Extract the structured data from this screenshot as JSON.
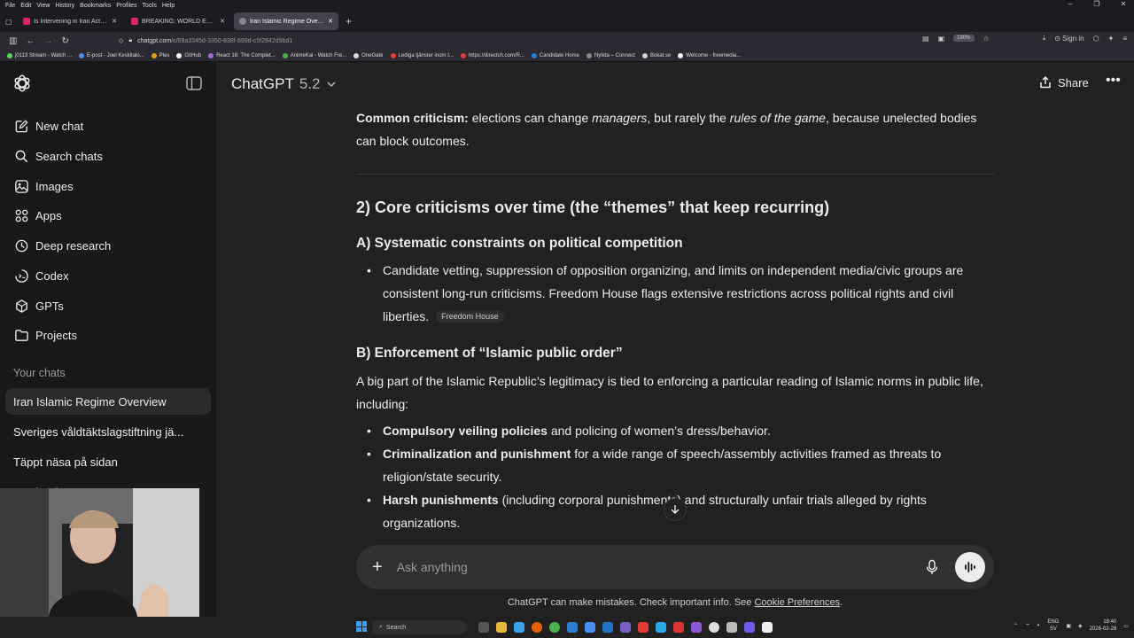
{
  "browser": {
    "menus": [
      "File",
      "Edit",
      "View",
      "History",
      "Bookmarks",
      "Profiles",
      "Tools",
      "Help"
    ],
    "tabs": [
      {
        "title": "Is Intervening in Iran Actually J..."
      },
      {
        "title": "BREAKING: WORLD ERUPTS AS..."
      },
      {
        "title": "Iran Islamic Regime Overview"
      }
    ],
    "url_host": "chatgpt.com",
    "url_path": "/c/69a3345d-3350-838f-899d-c5f2842d9bd1",
    "zoom": "190%",
    "sign_in": "Sign in",
    "bookmarks": [
      "j0113 Stream - Watch ...",
      "E-post - Joel Keskitalo...",
      "Plex",
      "GitHub",
      "React 16: The Complet...",
      "AnimeKai - Watch Fre...",
      "OneGate",
      "Lediga tjänster inom I...",
      "https://directch.com/R...",
      "Candidate Home",
      "Nytida – Connect",
      "Bokat.se",
      "Welcome - freemedia..."
    ]
  },
  "sidebar": {
    "items": [
      {
        "label": "New chat",
        "icon": "new-chat-icon"
      },
      {
        "label": "Search chats",
        "icon": "search-icon"
      },
      {
        "label": "Images",
        "icon": "images-icon"
      },
      {
        "label": "Apps",
        "icon": "apps-icon"
      },
      {
        "label": "Deep research",
        "icon": "deep-research-icon"
      },
      {
        "label": "Codex",
        "icon": "codex-icon"
      },
      {
        "label": "GPTs",
        "icon": "gpts-icon"
      },
      {
        "label": "Projects",
        "icon": "folder-icon"
      }
    ],
    "section_label": "Your chats",
    "chats": [
      {
        "title": "Iran Islamic Regime Overview"
      },
      {
        "title": "Sveriges våldtäktslagstiftning jä..."
      },
      {
        "title": "Täppt näsa på sidan"
      },
      {
        "title": "Gratis Chaos 2..."
      }
    ]
  },
  "header": {
    "model_name": "ChatGPT",
    "model_version": "5.2",
    "share_label": "Share"
  },
  "message": {
    "p1_bold": "Common criticism:",
    "p1_a": " elections can change ",
    "p1_em1": "managers",
    "p1_b": ", but rarely the ",
    "p1_em2": "rules of the game",
    "p1_c": ", because unelected bodies can block outcomes.",
    "h2": "2) Core criticisms over time (the “themes” that keep recurring)",
    "h3a": "A) Systematic constraints on political competition",
    "bullet_a1": "Candidate vetting, suppression of opposition organizing, and limits on independent media/civic groups are consistent long-run criticisms. Freedom House flags extensive restrictions across political rights and civil liberties.",
    "citation_a1": "Freedom House",
    "h3b": "B) Enforcement of “Islamic public order”",
    "p2": "A big part of the Islamic Republic’s legitimacy is tied to enforcing a particular reading of Islamic norms in public life, including:",
    "bullets_b": [
      {
        "bold": "Compulsory veiling policies",
        "text": " and policing of women’s dress/behavior."
      },
      {
        "bold": "Criminalization and punishment",
        "text": " for a wide range of speech/assembly activities framed as threats to religion/state security."
      },
      {
        "bold": "Harsh punishments",
        "text": " (including corporal punishments) and structurally unfair trials alleged by rights organizations."
      }
    ]
  },
  "composer": {
    "placeholder": "Ask anything"
  },
  "footer": {
    "disclaimer": "ChatGPT can make mistakes. Check important info. See ",
    "link": "Cookie Preferences",
    "end": "."
  },
  "taskbar": {
    "search_label": "Search",
    "lang_1": "ENG",
    "lang_2": "SV",
    "time": "18:40",
    "date": "2026-02-28"
  }
}
